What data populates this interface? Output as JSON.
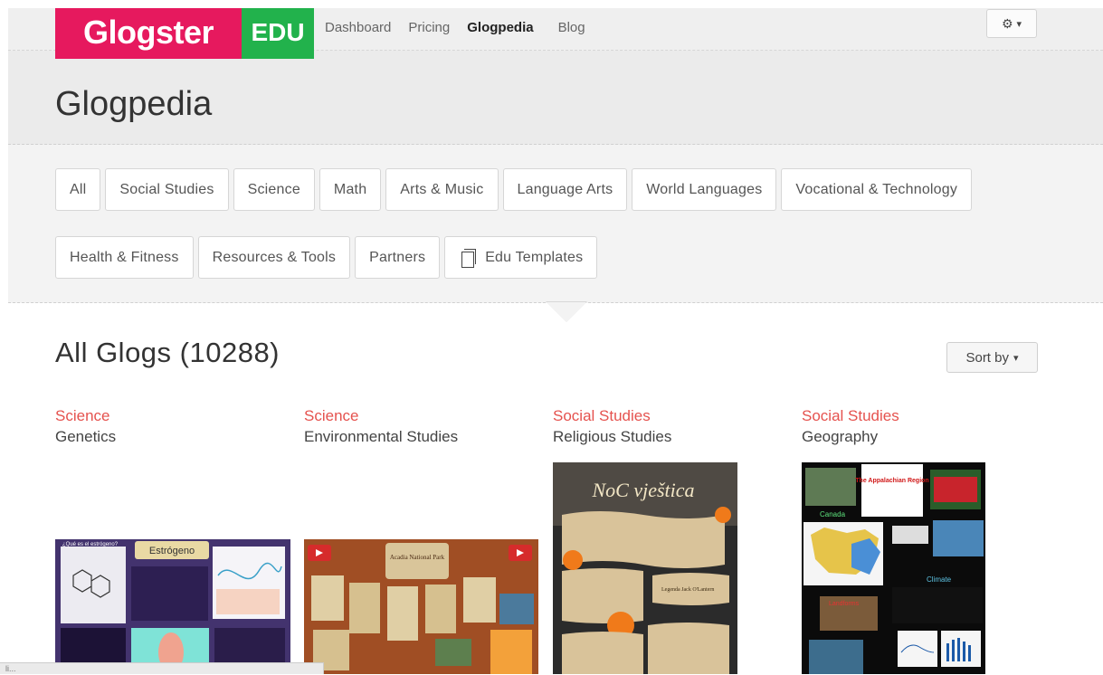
{
  "brand": {
    "name": "Glogster",
    "edu": "EDU"
  },
  "nav": {
    "links": [
      "Dashboard",
      "Pricing",
      "Glogpedia",
      "Blog"
    ],
    "active": "Glogpedia"
  },
  "settings": {
    "icon": "⚙",
    "caret": "▾"
  },
  "page": {
    "title": "Glogpedia"
  },
  "categories": {
    "row1": [
      "All",
      "Social Studies",
      "Science",
      "Math",
      "Arts & Music",
      "Language Arts",
      "World Languages",
      "Vocational & Technology"
    ],
    "row2": [
      "Health & Fitness",
      "Resources & Tools",
      "Partners",
      "Edu Templates"
    ]
  },
  "listing": {
    "title": "All Glogs (10288)",
    "sort_label": "Sort by",
    "sort_caret": "▾"
  },
  "glogs": [
    {
      "category": "Science",
      "subcategory": "Genetics",
      "thumb_title": "Estrógeno",
      "thumb_caption": "¿Qué es el estrógeno?"
    },
    {
      "category": "Science",
      "subcategory": "Environmental Studies",
      "thumb_title": "Acadia National Park"
    },
    {
      "category": "Social Studies",
      "subcategory": "Religious Studies",
      "thumb_title": "NoC vještica",
      "thumb_caption": "Legenda Jack O'Lantern"
    },
    {
      "category": "Social Studies",
      "subcategory": "Geography",
      "thumb_title": "The Appalachian Region",
      "thumb_labels": [
        "Canada",
        "Climate",
        "Landforms"
      ]
    }
  ],
  "status": {
    "text": "li..."
  },
  "colors": {
    "brand_pink": "#e6195e",
    "brand_green": "#22b24c",
    "category_red": "#e5524e"
  }
}
